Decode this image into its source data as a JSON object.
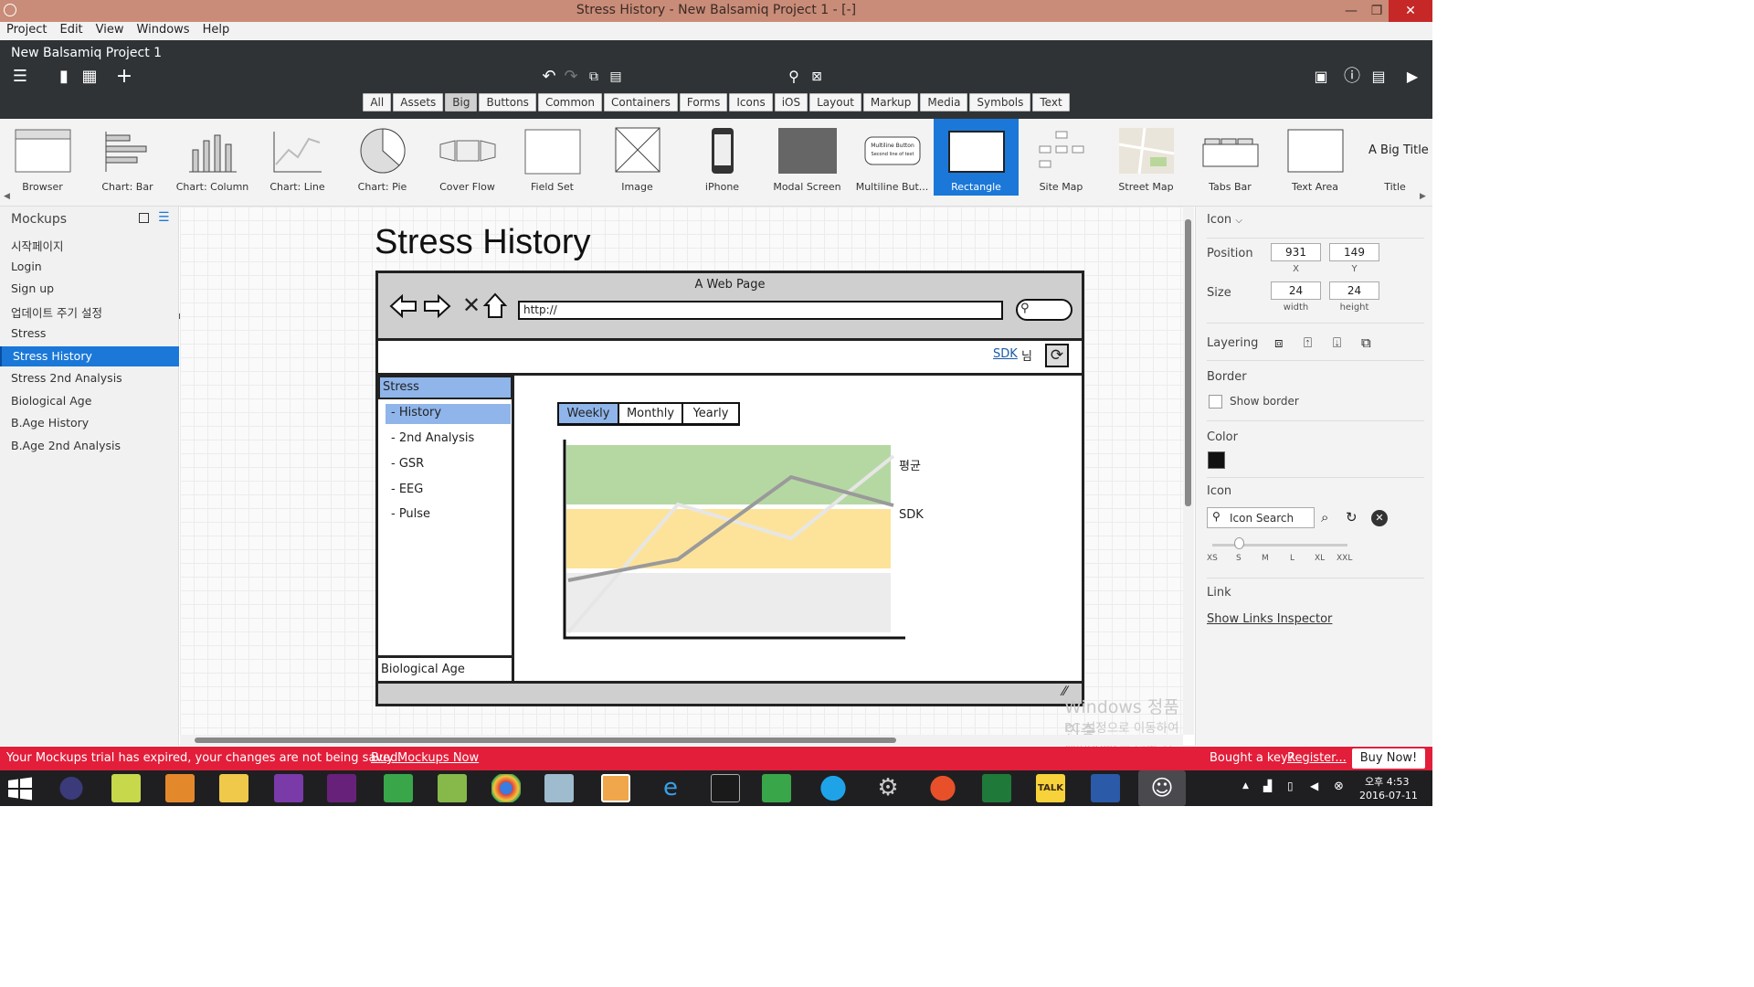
{
  "window": {
    "title": "Stress History - New Balsamiq Project 1 - [-]"
  },
  "menu": [
    "Project",
    "Edit",
    "View",
    "Windows",
    "Help"
  ],
  "project": {
    "title": "New Balsamiq Project 1"
  },
  "filters": [
    "All",
    "Assets",
    "Big",
    "Buttons",
    "Common",
    "Containers",
    "Forms",
    "Icons",
    "iOS",
    "Layout",
    "Markup",
    "Media",
    "Symbols",
    "Text"
  ],
  "filters_active": "Big",
  "library": [
    "Browser",
    "Chart: Bar",
    "Chart: Column",
    "Chart: Line",
    "Chart: Pie",
    "Cover Flow",
    "Field Set",
    "Image",
    "iPhone",
    "Modal Screen",
    "Multiline But...",
    "Rectangle",
    "Site Map",
    "Street Map",
    "Tabs Bar",
    "Text Area",
    "Title"
  ],
  "library_selected": "Rectangle",
  "library_thumb_text": {
    "multiline_button": [
      "Multiline Button",
      "Second line of text"
    ],
    "title": "A Big Title"
  },
  "mockups": {
    "header": "Mockups",
    "items": [
      "시작페이지",
      "Login",
      "Sign up",
      "업데이트 주기 설정",
      "Stress",
      "Stress History",
      "Stress 2nd Analysis",
      "Biological Age",
      "B.Age History",
      "B.Age 2nd Analysis"
    ],
    "selected": "Stress History"
  },
  "mockup": {
    "heading": "Stress History",
    "browser_title": "A Web Page",
    "url": "http://",
    "user_link": "SDK",
    "user_suffix": "님",
    "nav_header": "Stress",
    "nav_items": [
      "- History",
      "- 2nd Analysis",
      "- GSR",
      "- EEG",
      "- Pulse"
    ],
    "nav_footer": "Biological Age",
    "tabs": [
      "Weekly",
      "Monthly",
      "Yearly"
    ],
    "legend": [
      "평균",
      "SDK"
    ]
  },
  "inspector": {
    "header": "Icon",
    "position_label": "Position",
    "x": "931",
    "y": "149",
    "x_label": "X",
    "y_label": "Y",
    "size_label": "Size",
    "width": "24",
    "height": "24",
    "width_label": "width",
    "height_label": "height",
    "layering_label": "Layering",
    "border_label": "Border",
    "show_border": "Show border",
    "color_label": "Color",
    "color_value": "#111111",
    "icon_label": "Icon",
    "icon_search": "Icon Search",
    "sizes": [
      "XS",
      "S",
      "M",
      "L",
      "XL",
      "XXL"
    ],
    "link_label": "Link",
    "links_inspector": "Show Links Inspector"
  },
  "watermark": {
    "line1": "Windows 정품 인증",
    "line2": "PC 설정으로 이동하여 Windows를 정품 인증합니다."
  },
  "trial": {
    "message": "Your Mockups trial has expired, your changes are not being saved.",
    "buy_link": "Buy Mockups Now",
    "key_text": "Bought a key?",
    "register": "Register...",
    "buy_button": "Buy Now!"
  },
  "clock": {
    "time": "오후 4:53",
    "date": "2016-07-11"
  },
  "colors": {
    "accent": "#1b78d8",
    "trial_bar": "#e21e3a",
    "titlebar": "#c98c78",
    "toolbar": "#2f3336",
    "nav_highlight": "#8fb5ea"
  }
}
